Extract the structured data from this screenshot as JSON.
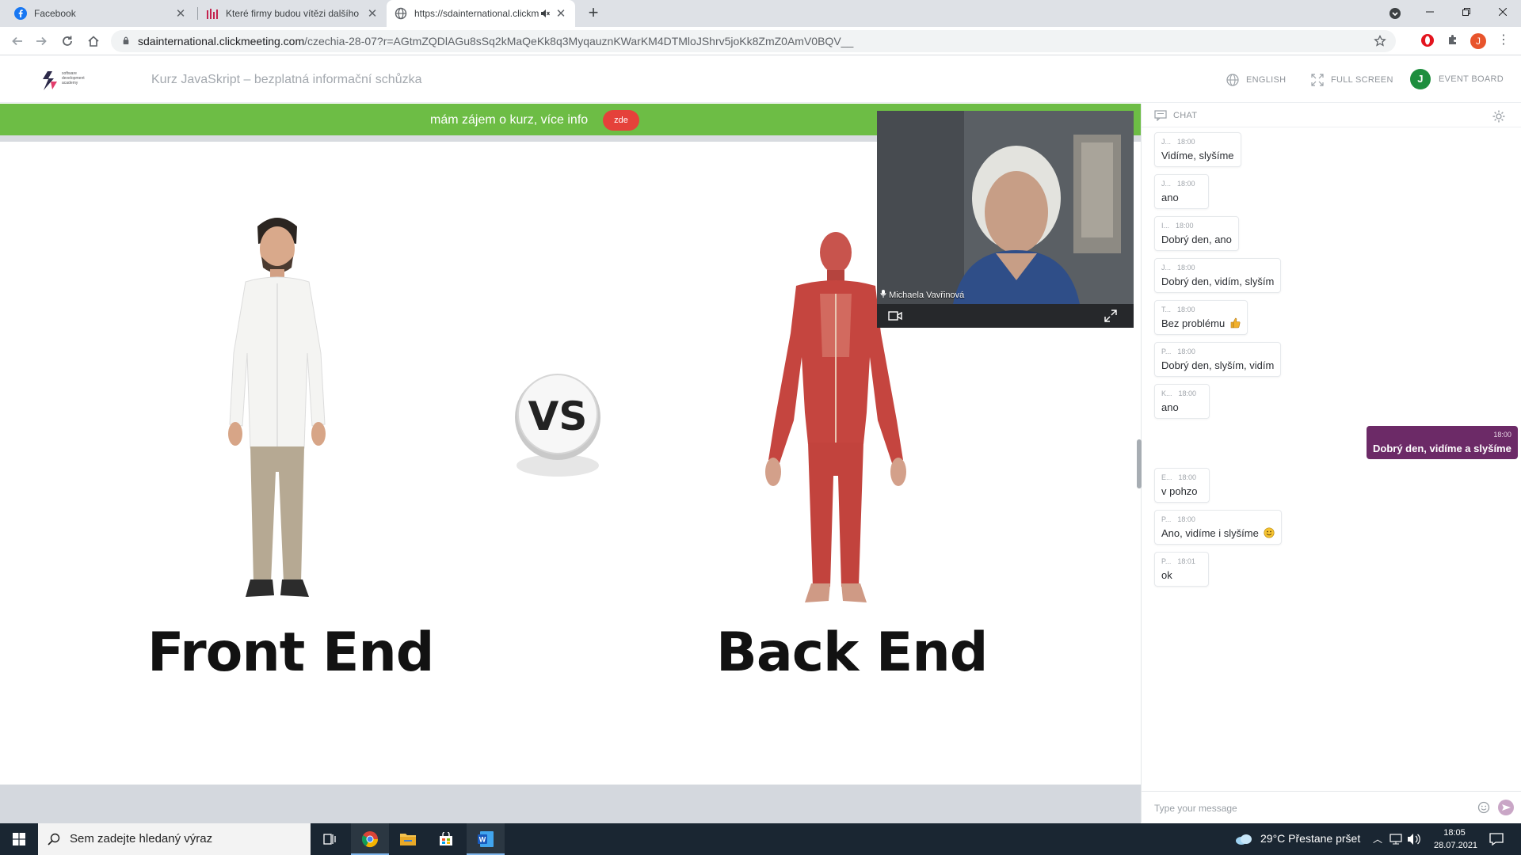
{
  "browser": {
    "tabs": [
      {
        "title": "Facebook",
        "favicon": "facebook-icon"
      },
      {
        "title": "Které firmy budou vítězi dalšího d",
        "favicon": "bar-chart-icon"
      },
      {
        "title": "https://sdainternational.clickm",
        "favicon": "globe-icon"
      }
    ],
    "new_tab_label": "+",
    "url_host": "sdainternational.clickmeeting.com",
    "url_path": "/czechia-28-07?r=AGtmZQDlAGu8sSq2kMaQeKk8q3MyqauznKWarKM4DTMloJShrv5joKk8ZmZ0AmV0BQV__",
    "profile_initial": "J"
  },
  "app": {
    "logo_text": "software development academy",
    "meeting_title": "Kurz JavaSkript – bezplatná informační schůzka",
    "language_label": "ENGLISH",
    "fullscreen_label": "FULL SCREEN",
    "event_board_label": "EVENT BOARD",
    "event_board_initial": "J"
  },
  "banner": {
    "text": "mám zájem o kurz, více info",
    "button": "zde",
    "color": "#6dbd45",
    "button_color": "#e5413a"
  },
  "slide": {
    "left_caption": "Front End",
    "right_caption": "Back End",
    "vs_text": "VS"
  },
  "video": {
    "presenter_name": "Michaela Vavřinová"
  },
  "chat": {
    "title": "CHAT",
    "placeholder": "Type your message",
    "accent": "#6c2a67",
    "messages": [
      {
        "author": "J...",
        "time": "18:00",
        "text": "Vidíme, slyšíme",
        "own": false
      },
      {
        "author": "J...",
        "time": "18:00",
        "text": "ano",
        "own": false
      },
      {
        "author": "I...",
        "time": "18:00",
        "text": "Dobrý den, ano",
        "own": false
      },
      {
        "author": "J...",
        "time": "18:00",
        "text": "Dobrý den, vidím, slyším",
        "own": false
      },
      {
        "author": "T...",
        "time": "18:00",
        "text": "Bez problému",
        "own": false,
        "emoji": "thumbs-up-icon"
      },
      {
        "author": "P...",
        "time": "18:00",
        "text": "Dobrý den, slyším, vidím",
        "own": false
      },
      {
        "author": "K...",
        "time": "18:00",
        "text": "ano",
        "own": false
      },
      {
        "author": "",
        "time": "18:00",
        "text": "Dobrý den, vidíme a slyšíme",
        "own": true
      },
      {
        "author": "E...",
        "time": "18:00",
        "text": "v pohzo",
        "own": false
      },
      {
        "author": "P...",
        "time": "18:00",
        "text": "Ano, vidíme i slyšíme",
        "own": false,
        "emoji": "smiley-icon"
      },
      {
        "author": "P...",
        "time": "18:01",
        "text": "ok",
        "own": false
      }
    ]
  },
  "taskbar": {
    "search_placeholder": "Sem zadejte hledaný výraz",
    "weather": "29°C  Přestane pršet",
    "time": "18:05",
    "date": "28.07.2021"
  }
}
